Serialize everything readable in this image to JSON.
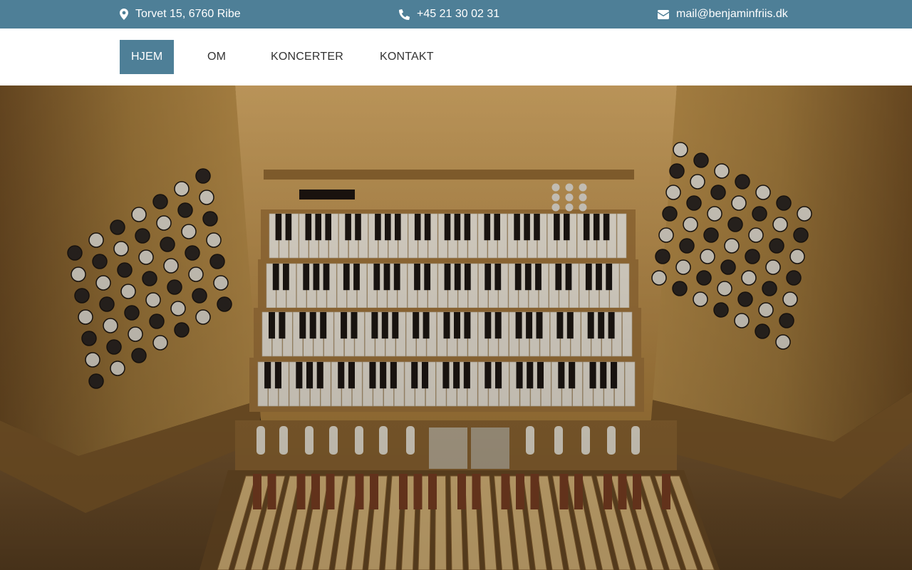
{
  "topbar": {
    "address": "Torvet 15, 6760 Ribe",
    "phone": "+45 21 30 02 31",
    "email": "mail@benjaminfriis.dk",
    "icons": [
      "map-marker-icon",
      "phone-icon",
      "envelope-icon"
    ]
  },
  "nav": {
    "items": [
      {
        "label": "HJEM",
        "active": true
      },
      {
        "label": "OM",
        "active": false
      },
      {
        "label": "KONCERTER",
        "active": false
      },
      {
        "label": "KONTAKT",
        "active": false
      }
    ]
  },
  "hero": {
    "subject": "organ console with four manuals, stop knobs and pedalboard"
  },
  "colors": {
    "accent": "#4e7f97",
    "nav_text": "#333333",
    "white": "#ffffff",
    "wood": "#b88a45"
  }
}
